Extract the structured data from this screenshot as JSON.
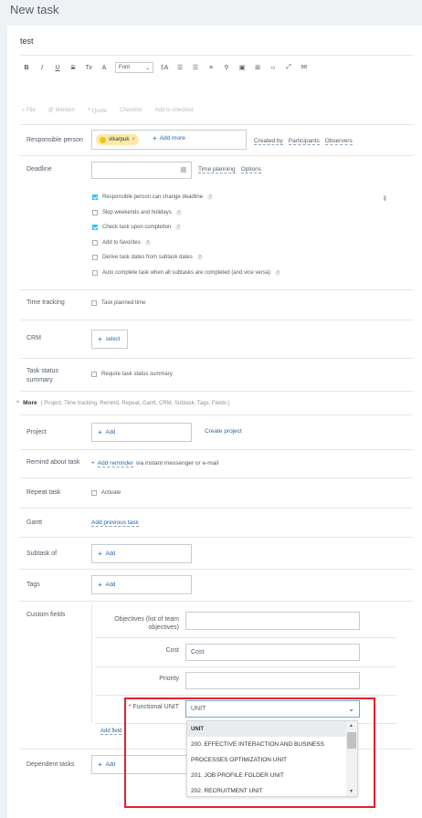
{
  "window": {
    "title": "New task"
  },
  "task": {
    "title": "test"
  },
  "toolbar": {
    "bold": "B",
    "italic": "I",
    "underline": "U",
    "strike": "S",
    "clear_format": "Tx",
    "font_value": "Font",
    "font_size": "‡A",
    "more": "BB"
  },
  "attach_bar": {
    "file": "File",
    "mention": "Mention",
    "quote": "Quote",
    "checklist": "Checklist",
    "add_to_checklist": "Add to checklist"
  },
  "responsible": {
    "label": "Responsible person",
    "chip_name": "vikarpuk",
    "chip_remove": "×",
    "add_more": "Add more",
    "created_by": "Created by",
    "participants": "Participants",
    "observers": "Observers"
  },
  "deadline": {
    "label": "Deadline",
    "time_planning": "Time planning",
    "options": "Options",
    "checkboxes": [
      {
        "label": "Responsible person can change deadline",
        "checked": true,
        "help": true
      },
      {
        "label": "Skip weekends and holidays",
        "checked": false,
        "help": true
      },
      {
        "label": "Check task upon completion",
        "checked": true,
        "help": true
      },
      {
        "label": "Add to favorites",
        "checked": false,
        "help": true
      },
      {
        "label": "Derive task dates from subtask dates",
        "checked": false,
        "help": true
      },
      {
        "label": "Auto complete task when all subtasks are completed (and vice versa)",
        "checked": false,
        "help": true
      }
    ]
  },
  "time_tracking": {
    "label": "Time tracking",
    "option": "Task planned time"
  },
  "crm": {
    "label": "CRM",
    "select": "select"
  },
  "status_summary": {
    "label_line1": "Task status",
    "label_line2": "summary",
    "option": "Require task status summary"
  },
  "more": {
    "label": "More",
    "hint": "( Project,  Time tracking,  Remind,  Repeat,  Gantt,  CRM,  Subtask,  Tags,  Fields )"
  },
  "project": {
    "label": "Project",
    "add": "Add",
    "create": "Create project"
  },
  "remind": {
    "label": "Remind about task",
    "add": "Add reminder",
    "rest": "via instant messenger or e-mail"
  },
  "repeat": {
    "label": "Repeat task",
    "option": "Activate"
  },
  "gantt": {
    "label": "Gantt",
    "add": "Add previous task"
  },
  "subtask": {
    "label": "Subtask of",
    "add": "Add"
  },
  "tags": {
    "label": "Tags",
    "add": "Add"
  },
  "custom_fields": {
    "label": "Custom fields",
    "objectives_label": "Objectives (list of team objectives)",
    "objectives_value": "",
    "cost_label": "Cost",
    "cost_placeholder": "Cost",
    "priority_label": "Priority",
    "priority_value": "",
    "unit_required": "*",
    "unit_label": "Functional UNIT",
    "unit_value": "UNIT",
    "add_field": "Add field"
  },
  "unit_dropdown": {
    "options": [
      "UNIT",
      "200. EFFECTIVE INTERACTION AND BUSINESS",
      "PROCESSES OPTIMIZATION UNIT",
      "201. JOB PROFILE FOLDER UNIT",
      "202. RECRUITMENT UNIT"
    ]
  },
  "dependent": {
    "label": "Dependent tasks",
    "add": "Add"
  },
  "colors": {
    "link": "#2067b0",
    "highlight": "#e4202c",
    "checkbox": "#2fc6f6"
  }
}
